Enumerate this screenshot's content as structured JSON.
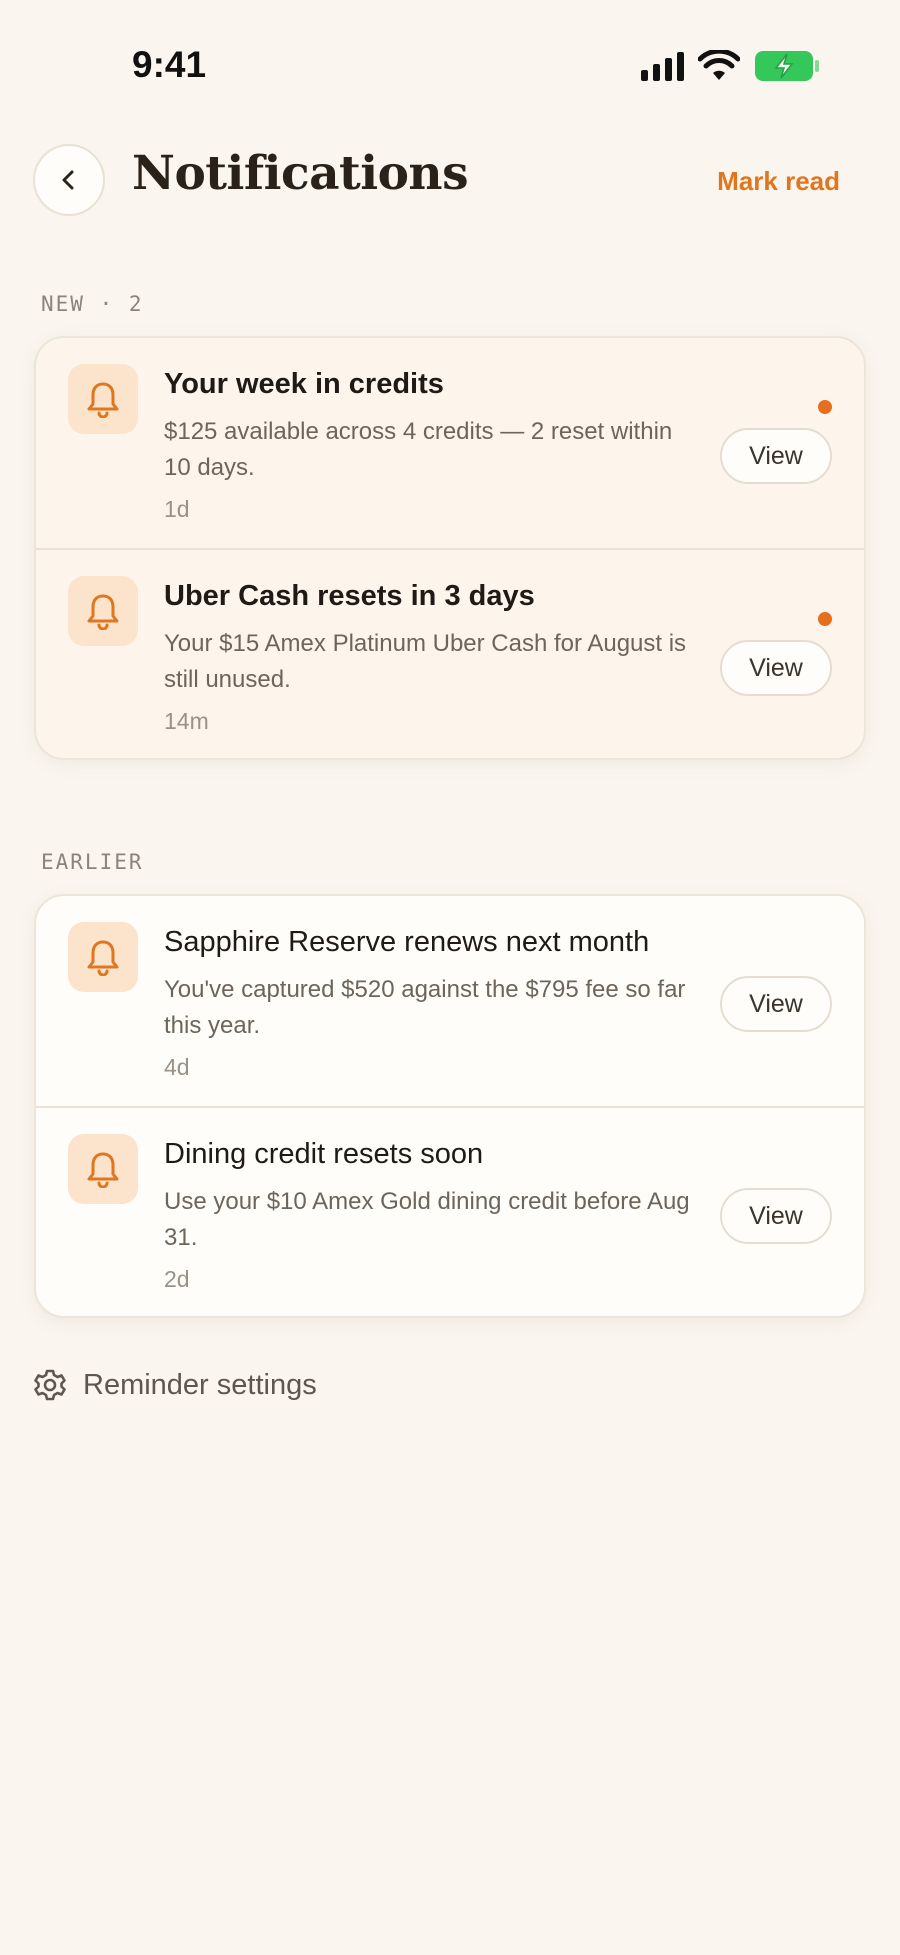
{
  "status_bar": {
    "time": "9:41",
    "icons": [
      "cellular-signal-icon",
      "wifi-icon",
      "battery-charging-icon"
    ],
    "battery_color": "#34c759"
  },
  "header": {
    "back_icon": "chevron-left-icon",
    "title": "Notifications",
    "mark_read_label": "Mark read"
  },
  "colors": {
    "accent": "#e0761f",
    "unread_dot": "#e56e1f",
    "icon_bg": "#fbe3cc",
    "background": "#faf6ef"
  },
  "sections": {
    "new": {
      "label": "NEW · 2",
      "items": [
        {
          "icon": "bell-icon",
          "title": "Your week in credits",
          "body": "$125 available across 4 credits — 2 reset within 10 days.",
          "time": "1d",
          "unread": true,
          "action": "View"
        },
        {
          "icon": "bell-icon",
          "title": "Uber Cash resets in 3 days",
          "body": "Your $15 Amex Platinum Uber Cash for August is still unused.",
          "time": "14m",
          "unread": true,
          "action": "View"
        }
      ]
    },
    "earlier": {
      "label": "EARLIER",
      "items": [
        {
          "icon": "bell-icon",
          "title": "Sapphire Reserve renews next month",
          "body": "You've captured $520 against the $795 fee so far this year.",
          "time": "4d",
          "unread": false,
          "action": "View"
        },
        {
          "icon": "bell-icon",
          "title": "Dining credit resets soon",
          "body": "Use your $10 Amex Gold dining credit before Aug 31.",
          "time": "2d",
          "unread": false,
          "action": "View"
        }
      ]
    }
  },
  "footer": {
    "icon": "gear-icon",
    "reminder_settings_label": "Reminder settings"
  }
}
